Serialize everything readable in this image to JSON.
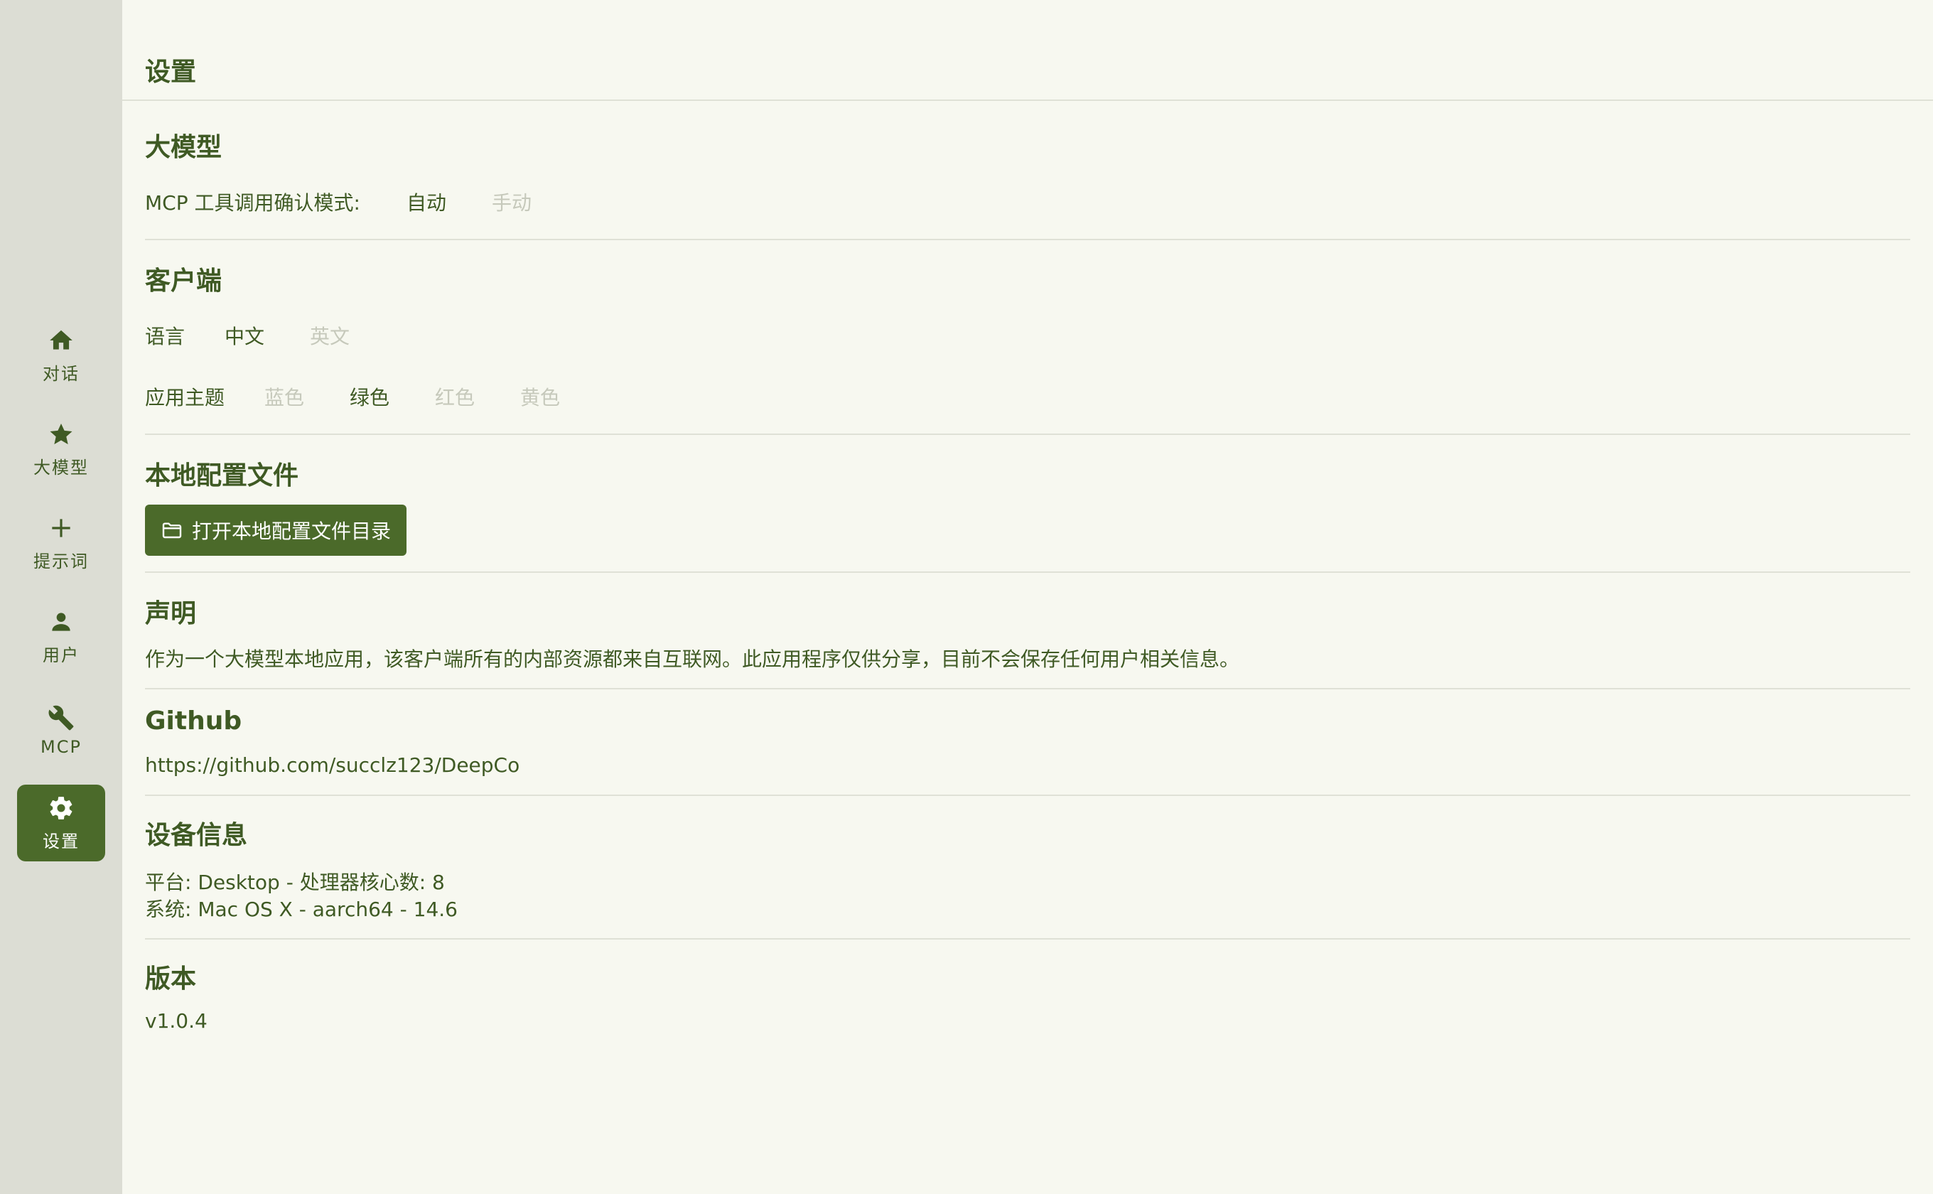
{
  "window": {
    "controls": [
      "close",
      "minimize",
      "maximize"
    ]
  },
  "sidebar": {
    "items": [
      {
        "label": "对话",
        "icon": "home-icon",
        "active": false
      },
      {
        "label": "大模型",
        "icon": "star-icon",
        "active": false
      },
      {
        "label": "提示词",
        "icon": "plus-icon",
        "active": false
      },
      {
        "label": "用户",
        "icon": "person-icon",
        "active": false
      },
      {
        "label": "MCP",
        "icon": "wrench-icon",
        "active": false
      },
      {
        "label": "设置",
        "icon": "gear-icon",
        "active": true
      }
    ]
  },
  "page": {
    "title": "设置"
  },
  "llm": {
    "heading": "大模型",
    "mcp_confirm_label": "MCP 工具调用确认模式:",
    "mcp_options": [
      "自动",
      "手动"
    ],
    "mcp_selected": "自动"
  },
  "client": {
    "heading": "客户端",
    "language_label": "语言",
    "language_options": [
      "中文",
      "英文"
    ],
    "language_selected": "中文",
    "theme_label": "应用主题",
    "theme_options": [
      "蓝色",
      "绿色",
      "红色",
      "黄色"
    ],
    "theme_selected": "绿色"
  },
  "local_config": {
    "heading": "本地配置文件",
    "open_button_label": "打开本地配置文件目录",
    "open_button_icon": "folder-icon"
  },
  "statement": {
    "heading": "声明",
    "text": "作为一个大模型本地应用，该客户端所有的内部资源都来自互联网。此应用程序仅供分享，目前不会保存任何用户相关信息。"
  },
  "github": {
    "heading": "Github",
    "url": "https://github.com/succlz123/DeepCo"
  },
  "device": {
    "heading": "设备信息",
    "platform_line": "平台: Desktop - 处理器核心数: 8",
    "system_line": "系统: Mac OS X - aarch64 - 14.6"
  },
  "version": {
    "heading": "版本",
    "value": "v1.0.4"
  },
  "colors": {
    "accent": "#4b6a2a",
    "text": "#3f5a24",
    "disabled": "#c6c9bb",
    "background": "#f7f8f0",
    "sidebar": "#dcddd4"
  }
}
